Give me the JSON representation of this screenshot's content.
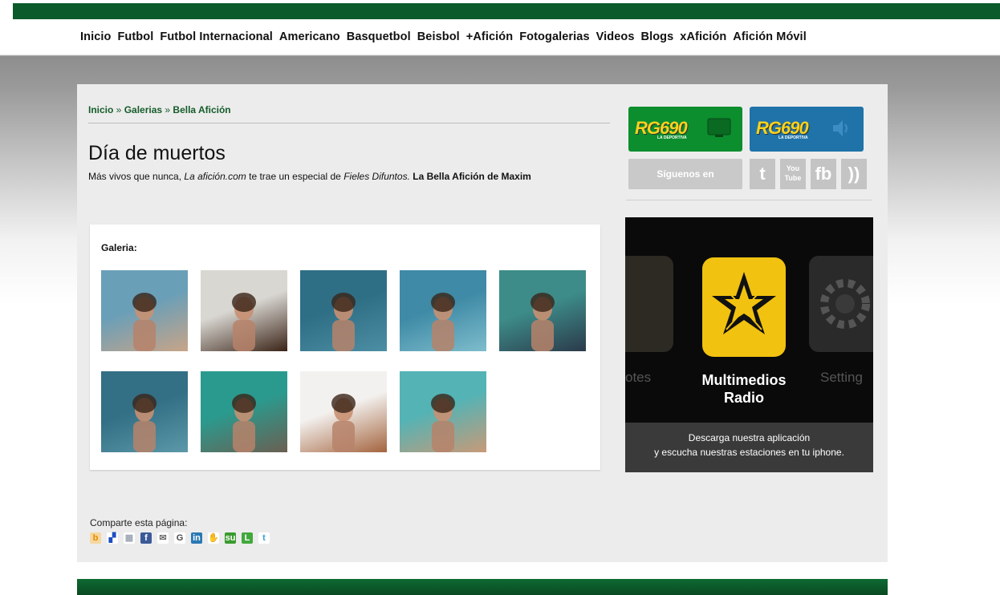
{
  "nav": {
    "items": [
      "Inicio",
      "Futbol",
      "Futbol Internacional",
      "Americano",
      "Basquetbol",
      "Beisbol",
      "+Afición",
      "Fotogalerias",
      "Videos",
      "Blogs",
      "xAfición",
      "Afición Móvil"
    ]
  },
  "breadcrumb": {
    "items": [
      "Inicio",
      "Galerias",
      "Bella Afición"
    ],
    "separator": "»"
  },
  "article": {
    "title": "Día de muertos",
    "subtitle_part1": "Más vivos que nunca, ",
    "subtitle_italic1": "La afición.com",
    "subtitle_part2": " te trae un especial de ",
    "subtitle_italic2": "Fieles Difuntos.",
    "subtitle_bold": " La Bella Afición de Maxim"
  },
  "gallery": {
    "label": "Galeria:",
    "thumbnails": [
      {
        "name": "thumb-1",
        "scene": "three women on boat",
        "colors": [
          "#6a9fb8",
          "#c8a488"
        ]
      },
      {
        "name": "thumb-2",
        "scene": "woman dark hair",
        "colors": [
          "#d9d7d2",
          "#3b2418"
        ]
      },
      {
        "name": "thumb-3",
        "scene": "woman waving in water",
        "colors": [
          "#2f6f86",
          "#4c8ea3"
        ]
      },
      {
        "name": "thumb-4",
        "scene": "woman riding dolphin",
        "colors": [
          "#3f8aa6",
          "#7ebdcc"
        ]
      },
      {
        "name": "thumb-5",
        "scene": "woman with dolphin",
        "colors": [
          "#3d8c8a",
          "#2b3a4a"
        ]
      },
      {
        "name": "thumb-6",
        "scene": "woman swimming",
        "colors": [
          "#336f85",
          "#5b98a8"
        ]
      },
      {
        "name": "thumb-7",
        "scene": "woman kissing dolphin",
        "colors": [
          "#2b9a8e",
          "#6a5f52"
        ]
      },
      {
        "name": "thumb-8",
        "scene": "woman on white background",
        "colors": [
          "#f3f1ef",
          "#a4643e"
        ]
      },
      {
        "name": "thumb-9",
        "scene": "woman close portrait",
        "colors": [
          "#54b3b5",
          "#c89a78"
        ]
      }
    ]
  },
  "sidebar": {
    "radio_logo": "RG690",
    "radio_sub": "LA DEPORTIVA",
    "radio_buttons": [
      {
        "name": "rg690-tv-button",
        "color": "#0c8e2e"
      },
      {
        "name": "rg690-audio-button",
        "color": "#1f73a8"
      }
    ],
    "siguenos": "Síguenos en",
    "social": [
      {
        "name": "twitter-icon",
        "glyph": "t"
      },
      {
        "name": "youtube-icon",
        "glyph": "You\nTube"
      },
      {
        "name": "facebook-icon",
        "glyph": "fb"
      },
      {
        "name": "rss-icon",
        "glyph": "))"
      }
    ],
    "app_ad": {
      "app_name_line1": "Multimedios",
      "app_name_line2": "Radio",
      "ghost_left": "otes",
      "ghost_right": "Setting",
      "caption_line1": "Descarga nuestra aplicación",
      "caption_line2": "y escucha nuestras estaciones  en tu iphone."
    }
  },
  "share": {
    "label": "Comparte esta página:",
    "icons": [
      {
        "name": "bebo-icon",
        "glyph": "b",
        "color": "#e38b00",
        "bg": "#f6d7a0"
      },
      {
        "name": "delicious-icon",
        "glyph": "▞",
        "color": "#1d4cc2",
        "bg": "#ffffff"
      },
      {
        "name": "digg-icon",
        "glyph": "▦",
        "color": "#9ea8b4",
        "bg": "#ffffff"
      },
      {
        "name": "facebook-share-icon",
        "glyph": "f",
        "color": "#ffffff",
        "bg": "#3b5b98"
      },
      {
        "name": "email-icon",
        "glyph": "✉",
        "color": "#6b6b6b",
        "bg": "#ffffff"
      },
      {
        "name": "google-icon",
        "glyph": "G",
        "color": "#4a4a4a",
        "bg": "#ffffff"
      },
      {
        "name": "linkedin-icon",
        "glyph": "in",
        "color": "#ffffff",
        "bg": "#2a78b3"
      },
      {
        "name": "myspace-icon",
        "glyph": "✋",
        "color": "#1f4f8a",
        "bg": "#ffffff"
      },
      {
        "name": "stumbleupon-icon",
        "glyph": "su",
        "color": "#ffffff",
        "bg": "#3a9b2e"
      },
      {
        "name": "technorati-icon",
        "glyph": "L",
        "color": "#ffffff",
        "bg": "#42a83c"
      },
      {
        "name": "twitter-share-icon",
        "glyph": "t",
        "color": "#34a3d8",
        "bg": "#ffffff"
      }
    ]
  },
  "colors": {
    "brand_green": "#0b5a2c",
    "link_green": "#155c2a"
  }
}
